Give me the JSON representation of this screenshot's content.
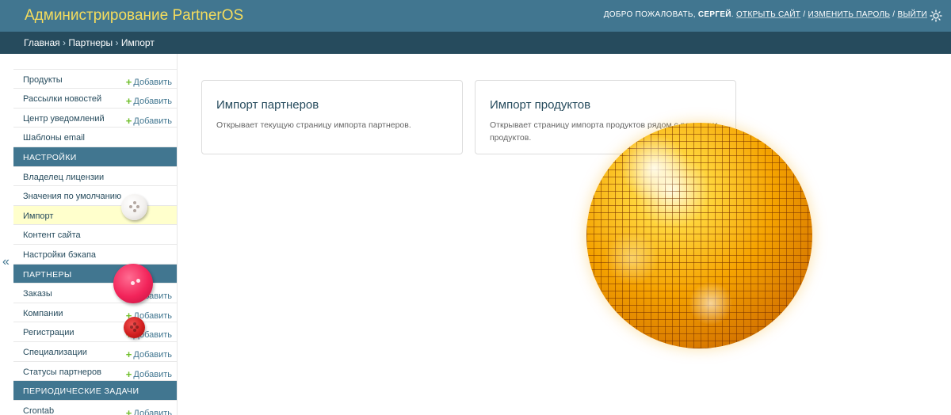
{
  "header": {
    "site_title": "Администрирование PartnerOS",
    "welcome": "ДОБРО ПОЖАЛОВАТЬ,",
    "username": "СЕРГЕЙ",
    "view_site": "ОТКРЫТЬ САЙТ",
    "change_password": "ИЗМЕНИТЬ ПАРОЛЬ",
    "logout": "ВЫЙТИ",
    "separator": "/",
    "theme_icon": "sun-icon"
  },
  "breadcrumbs": {
    "home": "Главная",
    "section": "Партнеры",
    "current": "Импорт",
    "separator": "›"
  },
  "sidebar": {
    "add_label": "Добавить",
    "plus": "+",
    "collapse_label": "«",
    "items": [
      {
        "label": "Продукты",
        "add": true
      },
      {
        "label": "Рассылки новостей",
        "add": true
      },
      {
        "label": "Центр уведомлений",
        "add": true
      },
      {
        "label": "Шаблоны email",
        "add": false
      }
    ],
    "settings_header": "Настройки",
    "settings_items": [
      {
        "label": "Владелец лицензии"
      },
      {
        "label": "Значения по умолчанию"
      },
      {
        "label": "Импорт",
        "active": true
      },
      {
        "label": "Контент сайта"
      },
      {
        "label": "Настройки бэкапа"
      }
    ],
    "partners_header": "Партнеры",
    "partners_items": [
      {
        "label": "Заказы",
        "add": true
      },
      {
        "label": "Компании",
        "add": true
      },
      {
        "label": "Регистрации",
        "add": true
      },
      {
        "label": "Специализации",
        "add": true
      },
      {
        "label": "Статусы партнеров",
        "add": true
      }
    ],
    "tasks_header": "Периодические задачи",
    "tasks_items": [
      {
        "label": "Crontab",
        "add": true
      }
    ]
  },
  "cards": {
    "partners": {
      "title": "Импорт партнеров",
      "description": "Открывает текущую страницу импорта партнеров."
    },
    "products": {
      "title": "Импорт продуктов",
      "description": "Открывает страницу импорта продуктов рядом с разделом продуктов."
    }
  },
  "colors": {
    "header_bg": "#417690",
    "breadcrumb_bg": "#264b5d",
    "title_yellow": "#f5dd5d",
    "add_plus": "#70bf2b",
    "active_row": "#ffffcc"
  }
}
